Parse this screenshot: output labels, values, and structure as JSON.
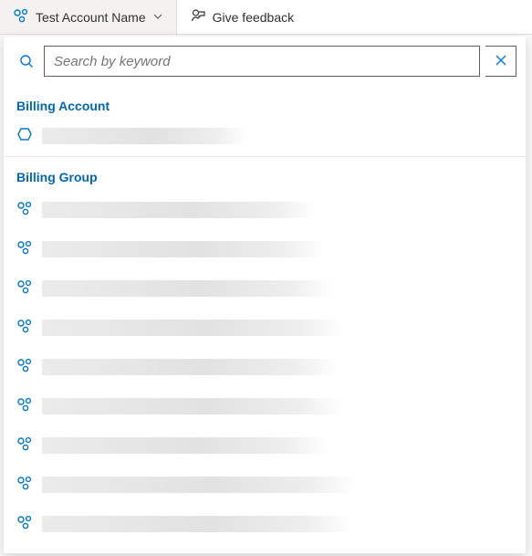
{
  "toolbar": {
    "account_label": "Test Account Name",
    "feedback_label": "Give feedback"
  },
  "search": {
    "placeholder": "Search by keyword"
  },
  "sections": {
    "billing_account": {
      "header": "Billing Account",
      "items": [
        {
          "label_width": 225
        }
      ]
    },
    "billing_group": {
      "header": "Billing Group",
      "items": [
        {
          "label_width": 300
        },
        {
          "label_width": 310
        },
        {
          "label_width": 320
        },
        {
          "label_width": 330
        },
        {
          "label_width": 325
        },
        {
          "label_width": 330
        },
        {
          "label_width": 315
        },
        {
          "label_width": 345
        },
        {
          "label_width": 340
        }
      ]
    }
  },
  "colors": {
    "accent": "#0078d4",
    "header_text": "#0068b7"
  }
}
